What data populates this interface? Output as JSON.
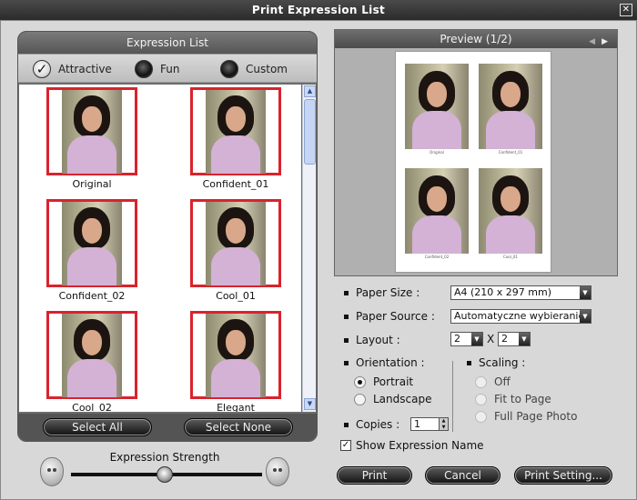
{
  "window": {
    "title": "Print Expression List",
    "close": "✕"
  },
  "expression_list": {
    "header": "Expression List",
    "tabs": [
      {
        "label": "Attractive",
        "selected": true
      },
      {
        "label": "Fun",
        "selected": false
      },
      {
        "label": "Custom",
        "selected": false
      }
    ],
    "items": [
      {
        "label": "Original"
      },
      {
        "label": "Confident_01"
      },
      {
        "label": "Confident_02"
      },
      {
        "label": "Cool_01"
      },
      {
        "label": "Cool_02"
      },
      {
        "label": "Elegant"
      }
    ],
    "select_all": "Select All",
    "select_none": "Select None"
  },
  "strength": {
    "label": "Expression Strength",
    "level": 0.5
  },
  "preview": {
    "title": "Preview (1/2)",
    "prev": "◀",
    "next": "▶",
    "page_labels": [
      "Original",
      "Confident_01",
      "Confident_02",
      "Cool_01"
    ]
  },
  "settings": {
    "paper_size_label": "Paper Size :",
    "paper_size_value": "A4 (210 x 297 mm)",
    "paper_source_label": "Paper Source :",
    "paper_source_value": "Automatyczne wybieranie",
    "layout_label": "Layout :",
    "layout_cols": "2",
    "layout_x": "X",
    "layout_rows": "2",
    "orientation_label": "Orientation :",
    "portrait": "Portrait",
    "landscape": "Landscape",
    "scaling_label": "Scaling :",
    "scaling_off": "Off",
    "scaling_fit": "Fit to Page",
    "scaling_full": "Full Page Photo",
    "copies_label": "Copies :",
    "copies_value": "1",
    "show_name_label": "Show Expression Name",
    "show_name_checked": true,
    "dropdown_arrow": "▼",
    "spin_up": "▲",
    "spin_down": "▼"
  },
  "buttons": {
    "print": "Print",
    "cancel": "Cancel",
    "print_setting": "Print Setting..."
  }
}
